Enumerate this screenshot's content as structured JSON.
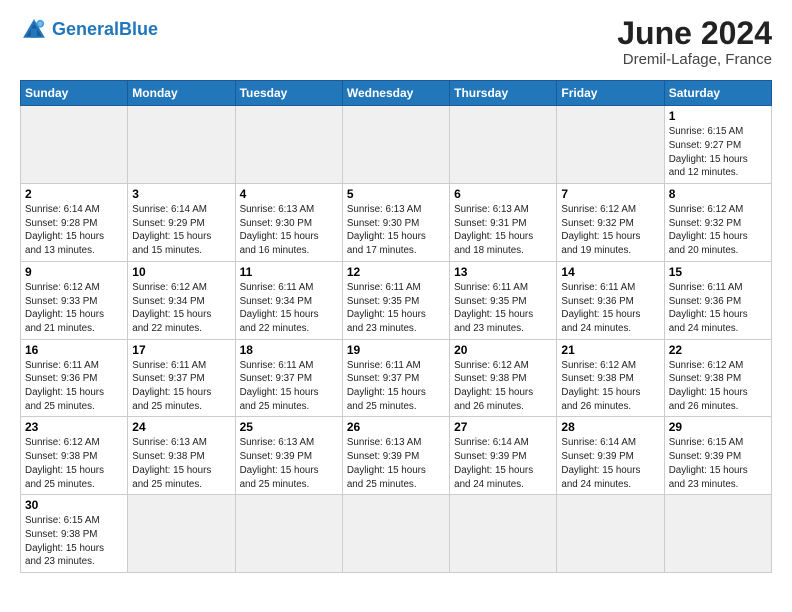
{
  "header": {
    "logo_general": "General",
    "logo_blue": "Blue",
    "month_title": "June 2024",
    "location": "Dremil-Lafage, France"
  },
  "days_of_week": [
    "Sunday",
    "Monday",
    "Tuesday",
    "Wednesday",
    "Thursday",
    "Friday",
    "Saturday"
  ],
  "weeks": [
    {
      "days": [
        {
          "num": "",
          "info": "",
          "empty": true
        },
        {
          "num": "",
          "info": "",
          "empty": true
        },
        {
          "num": "",
          "info": "",
          "empty": true
        },
        {
          "num": "",
          "info": "",
          "empty": true
        },
        {
          "num": "",
          "info": "",
          "empty": true
        },
        {
          "num": "",
          "info": "",
          "empty": true
        },
        {
          "num": "1",
          "info": "Sunrise: 6:15 AM\nSunset: 9:27 PM\nDaylight: 15 hours\nand 12 minutes.",
          "empty": false
        }
      ]
    },
    {
      "days": [
        {
          "num": "2",
          "info": "Sunrise: 6:14 AM\nSunset: 9:28 PM\nDaylight: 15 hours\nand 13 minutes.",
          "empty": false
        },
        {
          "num": "3",
          "info": "Sunrise: 6:14 AM\nSunset: 9:29 PM\nDaylight: 15 hours\nand 15 minutes.",
          "empty": false
        },
        {
          "num": "4",
          "info": "Sunrise: 6:13 AM\nSunset: 9:30 PM\nDaylight: 15 hours\nand 16 minutes.",
          "empty": false
        },
        {
          "num": "5",
          "info": "Sunrise: 6:13 AM\nSunset: 9:30 PM\nDaylight: 15 hours\nand 17 minutes.",
          "empty": false
        },
        {
          "num": "6",
          "info": "Sunrise: 6:13 AM\nSunset: 9:31 PM\nDaylight: 15 hours\nand 18 minutes.",
          "empty": false
        },
        {
          "num": "7",
          "info": "Sunrise: 6:12 AM\nSunset: 9:32 PM\nDaylight: 15 hours\nand 19 minutes.",
          "empty": false
        },
        {
          "num": "8",
          "info": "Sunrise: 6:12 AM\nSunset: 9:32 PM\nDaylight: 15 hours\nand 20 minutes.",
          "empty": false
        }
      ]
    },
    {
      "days": [
        {
          "num": "9",
          "info": "Sunrise: 6:12 AM\nSunset: 9:33 PM\nDaylight: 15 hours\nand 21 minutes.",
          "empty": false
        },
        {
          "num": "10",
          "info": "Sunrise: 6:12 AM\nSunset: 9:34 PM\nDaylight: 15 hours\nand 22 minutes.",
          "empty": false
        },
        {
          "num": "11",
          "info": "Sunrise: 6:11 AM\nSunset: 9:34 PM\nDaylight: 15 hours\nand 22 minutes.",
          "empty": false
        },
        {
          "num": "12",
          "info": "Sunrise: 6:11 AM\nSunset: 9:35 PM\nDaylight: 15 hours\nand 23 minutes.",
          "empty": false
        },
        {
          "num": "13",
          "info": "Sunrise: 6:11 AM\nSunset: 9:35 PM\nDaylight: 15 hours\nand 23 minutes.",
          "empty": false
        },
        {
          "num": "14",
          "info": "Sunrise: 6:11 AM\nSunset: 9:36 PM\nDaylight: 15 hours\nand 24 minutes.",
          "empty": false
        },
        {
          "num": "15",
          "info": "Sunrise: 6:11 AM\nSunset: 9:36 PM\nDaylight: 15 hours\nand 24 minutes.",
          "empty": false
        }
      ]
    },
    {
      "days": [
        {
          "num": "16",
          "info": "Sunrise: 6:11 AM\nSunset: 9:36 PM\nDaylight: 15 hours\nand 25 minutes.",
          "empty": false
        },
        {
          "num": "17",
          "info": "Sunrise: 6:11 AM\nSunset: 9:37 PM\nDaylight: 15 hours\nand 25 minutes.",
          "empty": false
        },
        {
          "num": "18",
          "info": "Sunrise: 6:11 AM\nSunset: 9:37 PM\nDaylight: 15 hours\nand 25 minutes.",
          "empty": false
        },
        {
          "num": "19",
          "info": "Sunrise: 6:11 AM\nSunset: 9:37 PM\nDaylight: 15 hours\nand 25 minutes.",
          "empty": false
        },
        {
          "num": "20",
          "info": "Sunrise: 6:12 AM\nSunset: 9:38 PM\nDaylight: 15 hours\nand 26 minutes.",
          "empty": false
        },
        {
          "num": "21",
          "info": "Sunrise: 6:12 AM\nSunset: 9:38 PM\nDaylight: 15 hours\nand 26 minutes.",
          "empty": false
        },
        {
          "num": "22",
          "info": "Sunrise: 6:12 AM\nSunset: 9:38 PM\nDaylight: 15 hours\nand 26 minutes.",
          "empty": false
        }
      ]
    },
    {
      "days": [
        {
          "num": "23",
          "info": "Sunrise: 6:12 AM\nSunset: 9:38 PM\nDaylight: 15 hours\nand 25 minutes.",
          "empty": false
        },
        {
          "num": "24",
          "info": "Sunrise: 6:13 AM\nSunset: 9:38 PM\nDaylight: 15 hours\nand 25 minutes.",
          "empty": false
        },
        {
          "num": "25",
          "info": "Sunrise: 6:13 AM\nSunset: 9:39 PM\nDaylight: 15 hours\nand 25 minutes.",
          "empty": false
        },
        {
          "num": "26",
          "info": "Sunrise: 6:13 AM\nSunset: 9:39 PM\nDaylight: 15 hours\nand 25 minutes.",
          "empty": false
        },
        {
          "num": "27",
          "info": "Sunrise: 6:14 AM\nSunset: 9:39 PM\nDaylight: 15 hours\nand 24 minutes.",
          "empty": false
        },
        {
          "num": "28",
          "info": "Sunrise: 6:14 AM\nSunset: 9:39 PM\nDaylight: 15 hours\nand 24 minutes.",
          "empty": false
        },
        {
          "num": "29",
          "info": "Sunrise: 6:15 AM\nSunset: 9:39 PM\nDaylight: 15 hours\nand 23 minutes.",
          "empty": false
        }
      ]
    },
    {
      "days": [
        {
          "num": "30",
          "info": "Sunrise: 6:15 AM\nSunset: 9:38 PM\nDaylight: 15 hours\nand 23 minutes.",
          "empty": false
        },
        {
          "num": "",
          "info": "",
          "empty": true
        },
        {
          "num": "",
          "info": "",
          "empty": true
        },
        {
          "num": "",
          "info": "",
          "empty": true
        },
        {
          "num": "",
          "info": "",
          "empty": true
        },
        {
          "num": "",
          "info": "",
          "empty": true
        },
        {
          "num": "",
          "info": "",
          "empty": true
        }
      ]
    }
  ]
}
